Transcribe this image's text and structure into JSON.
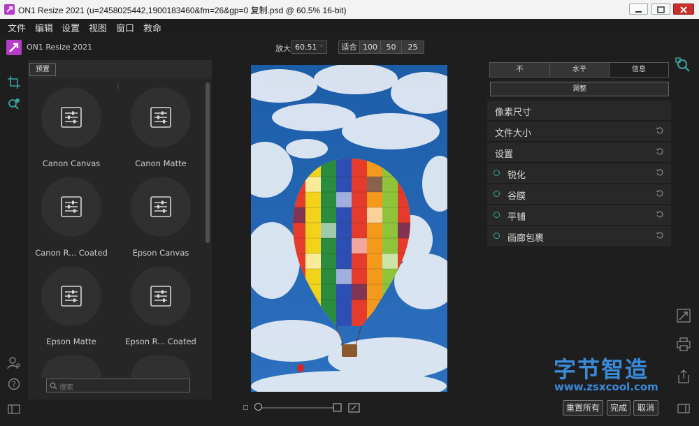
{
  "window": {
    "title": "ON1 Resize 2021 (u=2458025442,1900183460&fm=26&gp=0 复制.psd @ 60.5% 16-bit)"
  },
  "menu": [
    "文件",
    "编辑",
    "设置",
    "视图",
    "窗口",
    "救命"
  ],
  "header": {
    "app_name": "ON1 Resize 2021",
    "zoom_label": "放大",
    "zoom_value": "60.51",
    "zoom_buttons": [
      "适合",
      "100",
      "50",
      "25"
    ]
  },
  "presets": {
    "tab_label": "预置",
    "items": [
      {
        "label": "Canon Canvas"
      },
      {
        "label": "Canon Matte"
      },
      {
        "label": "Canon R... Coated"
      },
      {
        "label": "Epson Canvas"
      },
      {
        "label": "Epson Matte"
      },
      {
        "label": "Epson R... Coated"
      }
    ],
    "search_placeholder": "搜索"
  },
  "right_panel": {
    "tabs": [
      "不",
      "水平",
      "信息"
    ],
    "adjust_label": "调整",
    "sections": [
      {
        "label": "像素尺寸",
        "radio": false,
        "reset": false
      },
      {
        "label": "文件大小",
        "radio": false,
        "reset": true
      },
      {
        "label": "设置",
        "radio": false,
        "reset": true
      },
      {
        "label": "锐化",
        "radio": true,
        "reset": true
      },
      {
        "label": "谷膜",
        "radio": true,
        "reset": true
      },
      {
        "label": "平铺",
        "radio": true,
        "reset": true
      },
      {
        "label": "画廊包裹",
        "radio": true,
        "reset": true
      }
    ]
  },
  "footer": {
    "reset_all": "重置所有",
    "done": "完成",
    "cancel": "取消"
  },
  "watermark": {
    "text": "字节智造",
    "url": "www.zsxcool.com"
  },
  "colors": {
    "accent": "#3aa6a0",
    "logo": "#b43cc8",
    "watermark": "#3a8bd9"
  }
}
